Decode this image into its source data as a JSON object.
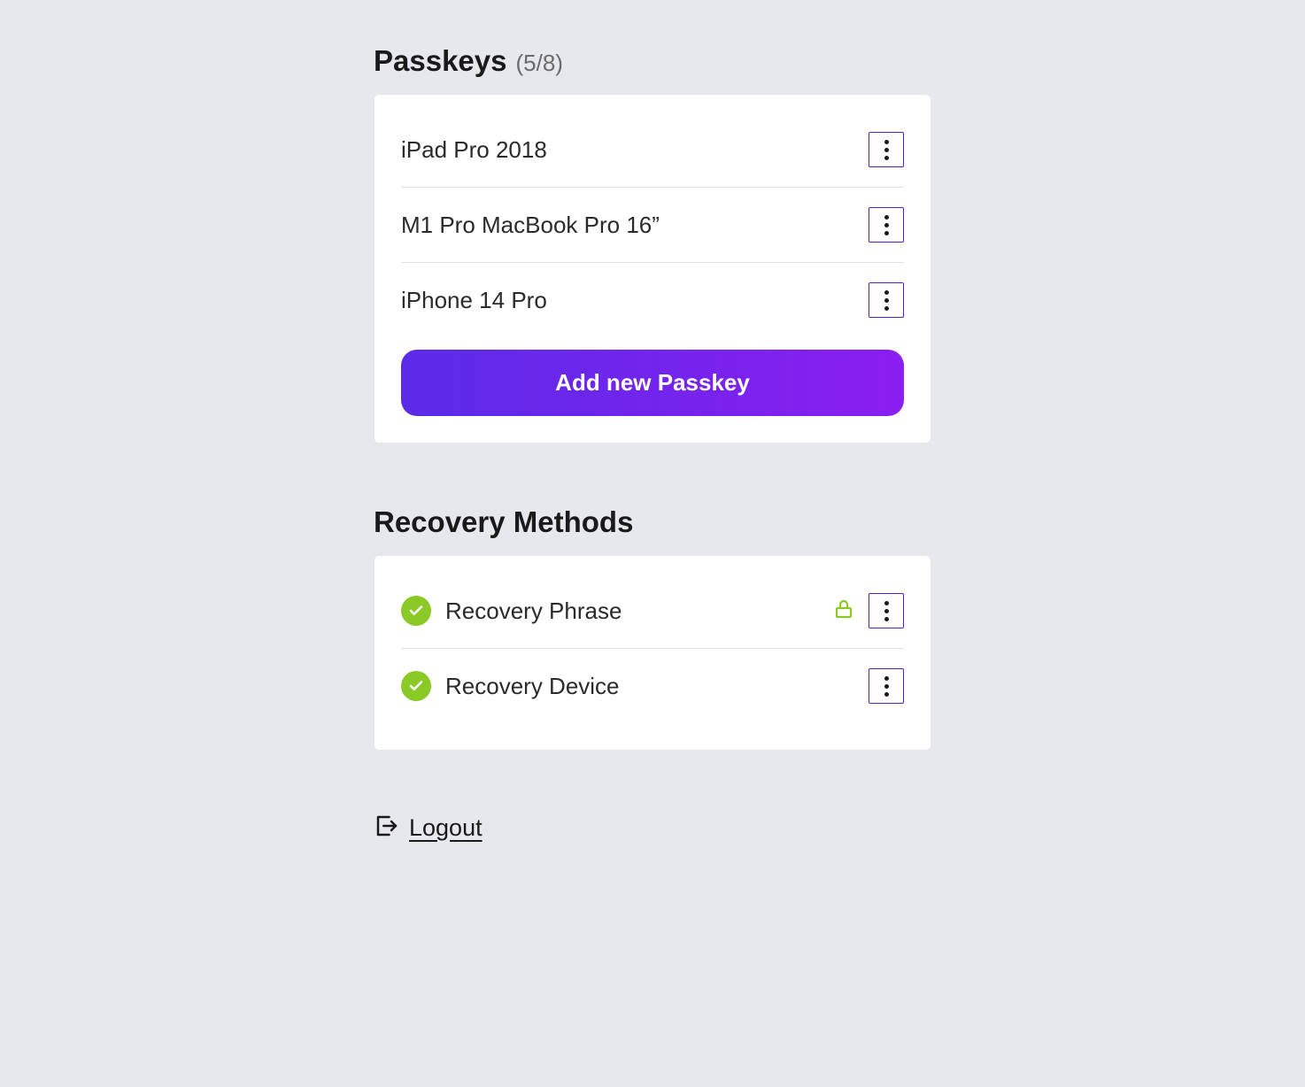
{
  "passkeys": {
    "title": "Passkeys",
    "count_label": "(5/8)",
    "items": [
      {
        "label": "iPad Pro 2018"
      },
      {
        "label": "M1 Pro MacBook Pro 16”"
      },
      {
        "label": "iPhone 14 Pro"
      }
    ],
    "add_button": "Add new Passkey"
  },
  "recovery": {
    "title": "Recovery Methods",
    "items": [
      {
        "label": "Recovery Phrase",
        "locked": true
      },
      {
        "label": "Recovery Device",
        "locked": false
      }
    ]
  },
  "logout": {
    "label": "Logout"
  }
}
